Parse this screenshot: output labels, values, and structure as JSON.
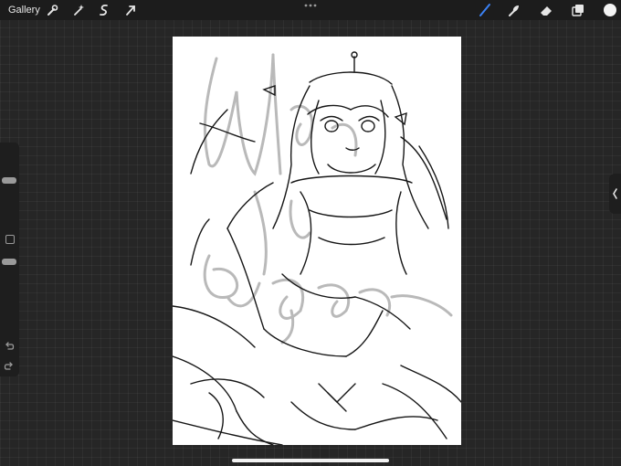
{
  "topbar": {
    "gallery_label": "Gallery",
    "left_tools": [
      "wrench-icon",
      "magic-wand-icon",
      "selection-icon",
      "transform-arrow-icon"
    ],
    "right_tools": [
      "brush-icon",
      "smudge-icon",
      "eraser-icon",
      "layers-icon",
      "color-circle-icon"
    ],
    "accent_color": "#3b82f6",
    "color_swatch": "#f2f2f2"
  },
  "sidebar": {
    "brush_size_slider": "size-slider",
    "opacity_slider": "opacity-slider",
    "modify_button": "modify-square-icon",
    "undo": "undo-icon",
    "redo": "redo-icon"
  },
  "canvas": {
    "background": "#ffffff",
    "watermark_strokes_color": "#b9b9b9",
    "lineart_color": "#111111"
  }
}
